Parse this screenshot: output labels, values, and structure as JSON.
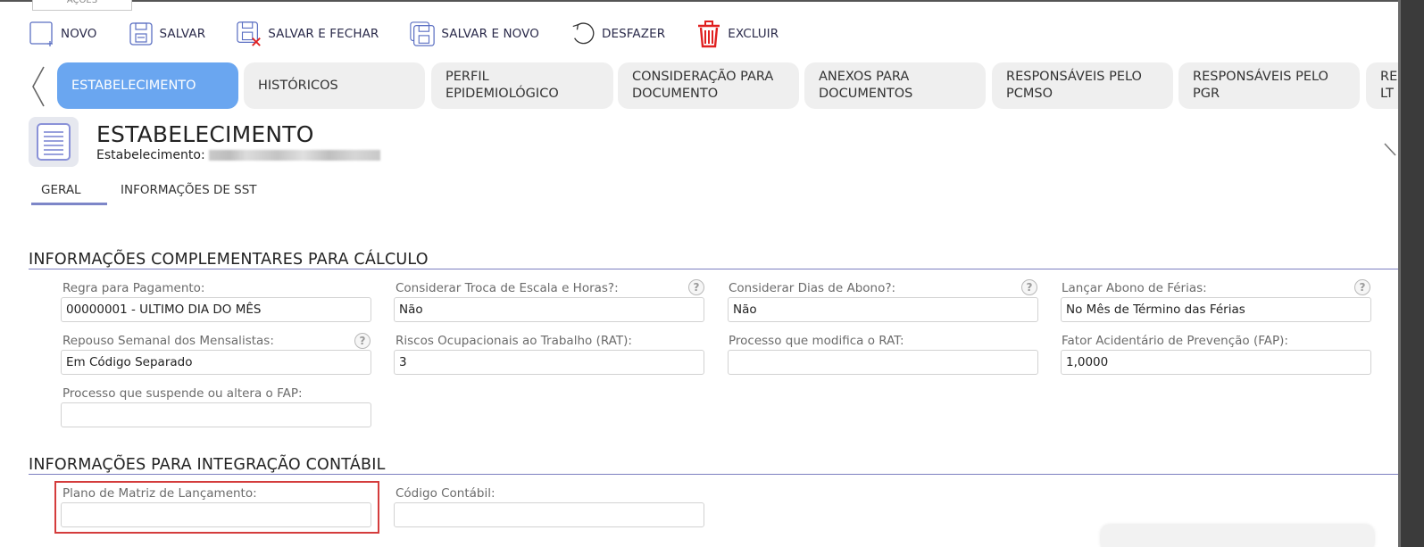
{
  "window": {
    "top_tab_label": "AÇÕES"
  },
  "toolbar": {
    "novo": "NOVO",
    "salvar": "SALVAR",
    "salvar_fechar": "SALVAR E FECHAR",
    "salvar_novo": "SALVAR E NOVO",
    "desfazer": "DESFAZER",
    "excluir": "EXCLUIR"
  },
  "tabs": [
    {
      "label": "ESTABELECIMENTO",
      "active": true
    },
    {
      "label": "HISTÓRICOS"
    },
    {
      "label": "PERFIL EPIDEMIOLÓGICO"
    },
    {
      "label": "CONSIDERAÇÃO PARA DOCUMENTO"
    },
    {
      "label": "ANEXOS PARA DOCUMENTOS"
    },
    {
      "label": "RESPONSÁVEIS PELO PCMSO"
    },
    {
      "label": "RESPONSÁVEIS PELO PGR"
    },
    {
      "label": "RE LT"
    }
  ],
  "header": {
    "title": "ESTABELECIMENTO",
    "subtitle_label": "Estabelecimento:"
  },
  "subtabs": [
    {
      "label": "GERAL",
      "active": true
    },
    {
      "label": "INFORMAÇÕES DE SST"
    }
  ],
  "sections": {
    "calculo": {
      "title": "INFORMAÇÕES COMPLEMENTARES PARA CÁLCULO",
      "fields": {
        "regra_pagamento": {
          "label": "Regra para Pagamento:",
          "value": "00000001 - ULTIMO DIA DO MÊS"
        },
        "troca_escala": {
          "label": "Considerar Troca de Escala e Horas?:",
          "value": "Não"
        },
        "dias_abono": {
          "label": "Considerar Dias de Abono?:",
          "value": "Não"
        },
        "abono_ferias": {
          "label": "Lançar Abono de Férias:",
          "value": "No Mês de Término das Férias"
        },
        "repouso_semanal": {
          "label": "Repouso Semanal dos Mensalistas:",
          "value": "Em Código Separado"
        },
        "rat": {
          "label": "Riscos Ocupacionais ao Trabalho (RAT):",
          "value": "3"
        },
        "processo_rat": {
          "label": "Processo que modifica o RAT:",
          "value": ""
        },
        "fap": {
          "label": "Fator Acidentário de Prevenção (FAP):",
          "value": "1,0000"
        },
        "processo_fap": {
          "label": "Processo que suspende ou altera o FAP:",
          "value": ""
        }
      }
    },
    "contabil": {
      "title": "INFORMAÇÕES PARA INTEGRAÇÃO CONTÁBIL",
      "fields": {
        "plano_matriz": {
          "label": "Plano de Matriz de Lançamento:",
          "value": ""
        },
        "codigo_contabil": {
          "label": "Código Contábil:",
          "value": ""
        }
      }
    }
  },
  "help_glyph": "?",
  "colors": {
    "accent": "#6aa6f0",
    "section_line": "#7c7fc0",
    "highlight": "#d43c3c",
    "delete_icon": "#e02020"
  }
}
